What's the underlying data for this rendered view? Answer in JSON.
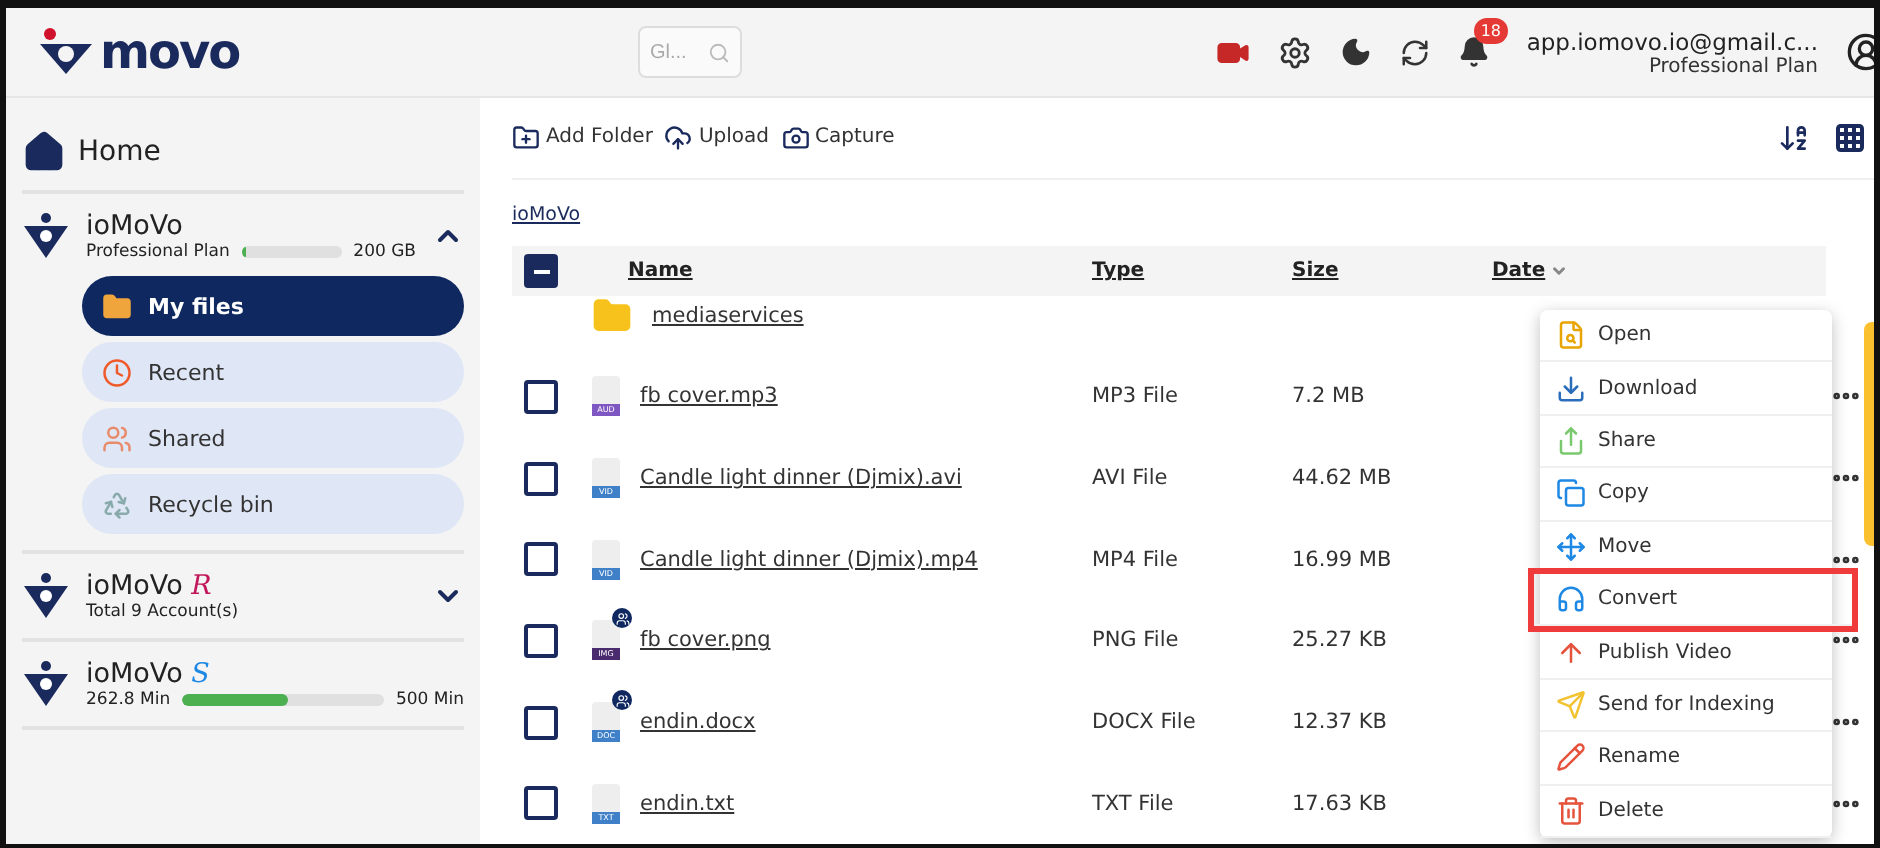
{
  "header": {
    "logo": "movo",
    "search": {
      "placeholder": "Gl..."
    },
    "notifications": "18",
    "account": {
      "email": "app.iomovo.io@gmail.c...",
      "plan": "Professional Plan"
    }
  },
  "sidebar": {
    "home": "Home",
    "accounts": [
      {
        "kind": "storage",
        "name": "ioMoVo",
        "sub": "Professional Plan",
        "level": 0.04,
        "total": "200 GB",
        "expanded": true
      },
      {
        "kind": "count",
        "name": "ioMoVo",
        "suffix": "R",
        "sub": "Total 9 Account(s)",
        "expanded": false
      },
      {
        "kind": "minutes",
        "name": "ioMoVo",
        "suffix": "S",
        "used": "262.8 Min",
        "level": 0.525,
        "total": "500 Min"
      }
    ],
    "items": [
      {
        "label": "My files",
        "selected": true
      },
      {
        "label": "Recent",
        "selected": false
      },
      {
        "label": "Shared",
        "selected": false
      },
      {
        "label": "Recycle bin",
        "selected": false
      }
    ]
  },
  "toolbar": [
    "Add Folder",
    "Upload",
    "Capture"
  ],
  "breadcrumb": "ioMoVo",
  "table": {
    "select_all": {
      "indeterminate": true
    },
    "columns": [
      "Name",
      "Type",
      "Size",
      "Date"
    ],
    "rows": [
      {
        "kind": "folder",
        "name": "mediaservices"
      },
      {
        "kind": "file",
        "checked": false,
        "badge": "AUD",
        "shared": false,
        "name": "fb cover.mp3",
        "type": "MP3 File",
        "size": "7.2 MB"
      },
      {
        "kind": "file",
        "checked": false,
        "badge": "VID",
        "shared": false,
        "name": "Candle light dinner (Djmix).avi",
        "type": "AVI File",
        "size": "44.62 MB"
      },
      {
        "kind": "file",
        "checked": false,
        "badge": "VID",
        "shared": false,
        "name": "Candle light dinner (Djmix).mp4",
        "type": "MP4 File",
        "size": "16.99 MB"
      },
      {
        "kind": "file",
        "checked": false,
        "badge": "IMG",
        "shared": true,
        "name": "fb cover.png",
        "type": "PNG File",
        "size": "25.27 KB"
      },
      {
        "kind": "file",
        "checked": false,
        "badge": "DOC",
        "shared": true,
        "name": "endin.docx",
        "type": "DOCX File",
        "size": "12.37 KB"
      },
      {
        "kind": "file",
        "checked": false,
        "badge": "TXT",
        "shared": false,
        "name": "endin.txt",
        "type": "TXT File",
        "size": "17.63 KB"
      }
    ]
  },
  "context_menu": [
    {
      "label": "Open",
      "highlighted": false
    },
    {
      "label": "Download",
      "highlighted": false
    },
    {
      "label": "Share",
      "highlighted": false
    },
    {
      "label": "Copy",
      "highlighted": false
    },
    {
      "label": "Move",
      "highlighted": false
    },
    {
      "label": "Convert",
      "highlighted": true
    },
    {
      "label": "Publish Video",
      "highlighted": false
    },
    {
      "label": "Send for Indexing",
      "highlighted": false
    },
    {
      "label": "Rename",
      "highlighted": false
    },
    {
      "label": "Delete",
      "highlighted": false
    }
  ]
}
